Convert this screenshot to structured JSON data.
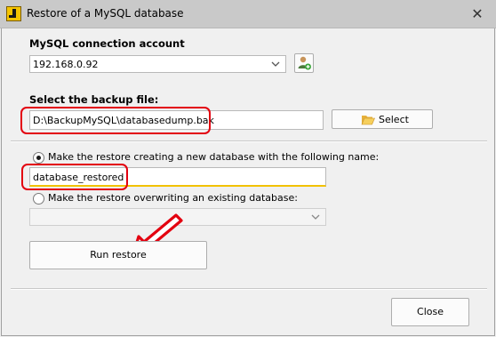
{
  "window": {
    "title": "Restore of a MySQL database",
    "close_glyph": "✕"
  },
  "connection": {
    "label": "MySQL connection account",
    "selected": "192.168.0.92",
    "icon": "user-add-icon"
  },
  "backup": {
    "label": "Select the backup file:",
    "path": "D:\\BackupMySQL\\databasedump.bak",
    "select_label": "Select",
    "select_icon": "folder-open-icon"
  },
  "options": {
    "new_db_label": "Make the restore creating a new database with the following name:",
    "new_db_selected": true,
    "new_db_name": "database_restored",
    "overwrite_label": "Make the restore overwriting an existing database:",
    "overwrite_selected": false,
    "overwrite_value": ""
  },
  "actions": {
    "run_label": "Run restore",
    "close_label": "Close"
  },
  "colors": {
    "highlight": "#e3000f",
    "focus_underline": "#f2c200"
  }
}
